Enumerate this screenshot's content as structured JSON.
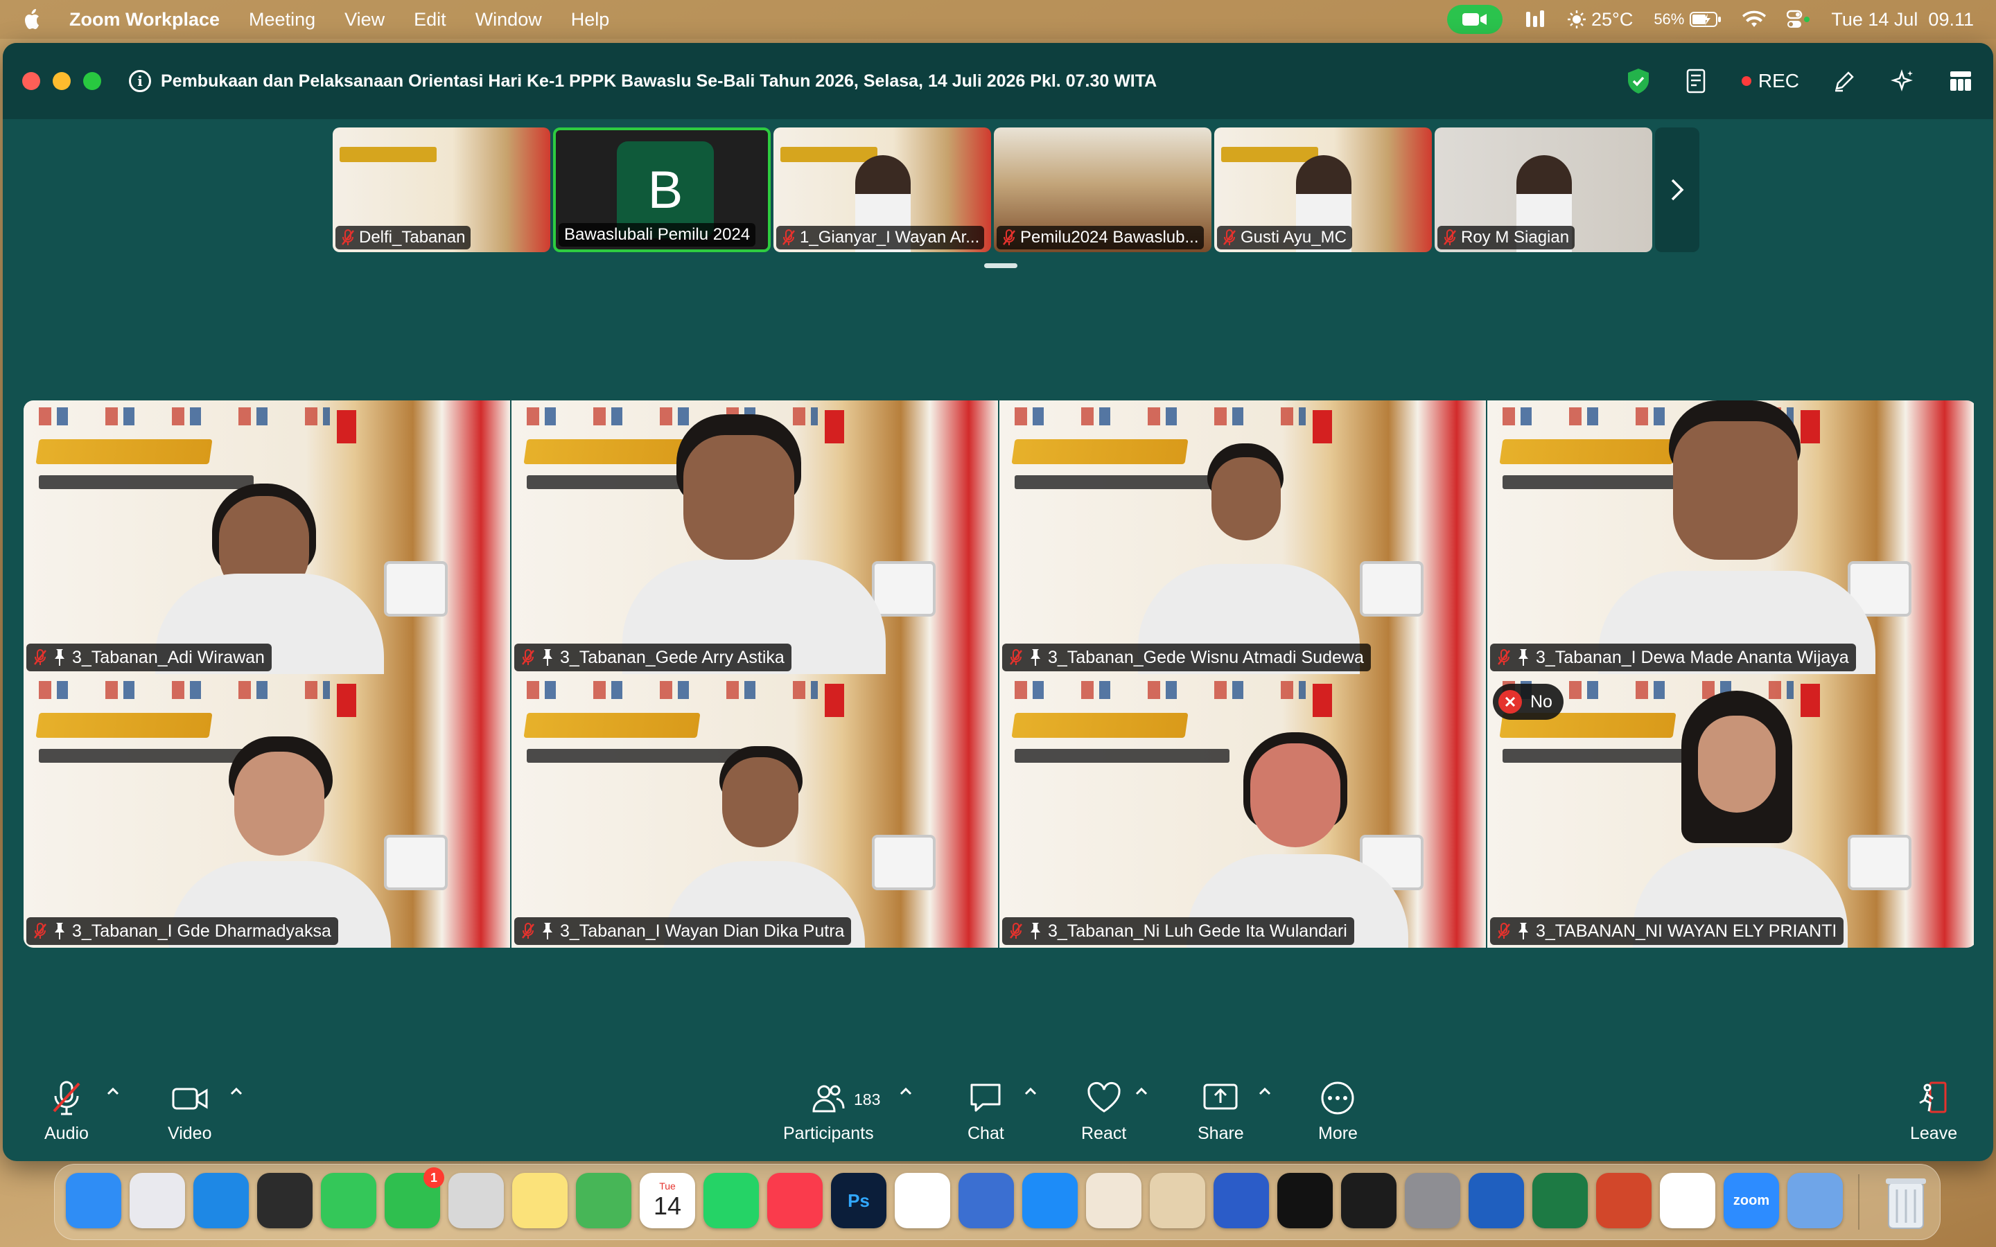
{
  "menubar": {
    "app_name": "Zoom Workplace",
    "menus": [
      "Meeting",
      "View",
      "Edit",
      "Window",
      "Help"
    ],
    "weather": "25°C",
    "battery": "56%",
    "clock": "Tue 14 Jul  09.11"
  },
  "window": {
    "meeting_title": "Pembukaan dan Pelaksanaan Orientasi Hari Ke-1 PPPK Bawaslu Se-Bali Tahun 2026, Selasa, 14 Juli 2026 Pkl. 07.30 WITA",
    "rec_label": "REC"
  },
  "filmstrip": [
    {
      "name": "Delfi_Tabanan",
      "muted": true,
      "kind": "slide"
    },
    {
      "name": "Bawaslubali Pemilu 2024",
      "muted": false,
      "kind": "avatar",
      "avatar_letter": "B"
    },
    {
      "name": "1_Gianyar_I Wayan Ar...",
      "muted": true,
      "kind": "person"
    },
    {
      "name": "Pemilu2024 Bawaslub...",
      "muted": true,
      "kind": "room"
    },
    {
      "name": "Gusti Ayu_MC",
      "muted": true,
      "kind": "person"
    },
    {
      "name": "Roy M Siagian",
      "muted": true,
      "kind": "person"
    }
  ],
  "gallery": [
    {
      "name": "3_Tabanan_Adi Wirawan",
      "pinned": true
    },
    {
      "name": "3_Tabanan_Gede Arry Astika",
      "pinned": true
    },
    {
      "name": "3_Tabanan_Gede Wisnu Atmadi Sudewa",
      "pinned": true
    },
    {
      "name": "3_Tabanan_I Dewa Made Ananta Wijaya",
      "pinned": true
    },
    {
      "name": "3_Tabanan_I Gde Dharmadyaksa",
      "pinned": true
    },
    {
      "name": "3_Tabanan_I Wayan Dian Dika Putra",
      "pinned": true
    },
    {
      "name": "3_Tabanan_Ni Luh Gede Ita Wulandari",
      "pinned": true
    },
    {
      "name": "3_TABANAN_NI WAYAN ELY PRIANTI",
      "pinned": true
    }
  ],
  "reaction_badge": {
    "label": "No"
  },
  "toolbar": {
    "audio": "Audio",
    "video": "Video",
    "participants": "Participants",
    "participants_count": "183",
    "chat": "Chat",
    "react": "React",
    "share": "Share",
    "more": "More",
    "leave": "Leave"
  },
  "dock": {
    "apps": [
      {
        "name": "finder",
        "label": "",
        "color": "#2f8df5"
      },
      {
        "name": "launchpad",
        "label": "",
        "color": "#e9e9ee"
      },
      {
        "name": "safari",
        "label": "",
        "color": "#1e88e5"
      },
      {
        "name": "keychain",
        "label": "",
        "color": "#2c2c2c"
      },
      {
        "name": "messages",
        "label": "",
        "color": "#34c759"
      },
      {
        "name": "facetime",
        "label": "",
        "color": "#2fbf4f",
        "badge": "1"
      },
      {
        "name": "calculator",
        "label": "",
        "color": "#d8d8d8"
      },
      {
        "name": "notes",
        "label": "",
        "color": "#fbe27a"
      },
      {
        "name": "find-my",
        "label": "",
        "color": "#47b657"
      },
      {
        "name": "calendar",
        "label": "14",
        "month": "Tue",
        "color": "#ffffff"
      },
      {
        "name": "whatsapp",
        "label": "",
        "color": "#25d366"
      },
      {
        "name": "music",
        "label": "",
        "color": "#fa3b4c"
      },
      {
        "name": "photoshop",
        "label": "Ps",
        "color": "#0b1e3a"
      },
      {
        "name": "capcut",
        "label": "",
        "color": "#ffffff"
      },
      {
        "name": "migrate",
        "label": "",
        "color": "#3b6fd1"
      },
      {
        "name": "app-store",
        "label": "",
        "color": "#1d8cf8"
      },
      {
        "name": "stack",
        "label": "",
        "color": "#f1e6d6"
      },
      {
        "name": "reader",
        "label": "",
        "color": "#e5d1ad"
      },
      {
        "name": "dictionary",
        "label": "",
        "color": "#2b5cc8"
      },
      {
        "name": "spotify",
        "label": "",
        "color": "#121212"
      },
      {
        "name": "istat",
        "label": "",
        "color": "#1c1c1c"
      },
      {
        "name": "system-settings",
        "label": "",
        "color": "#8e8e93"
      },
      {
        "name": "word",
        "label": "",
        "color": "#1f5fbf"
      },
      {
        "name": "excel",
        "label": "",
        "color": "#1d7a44"
      },
      {
        "name": "powerpoint",
        "label": "",
        "color": "#d2472a"
      },
      {
        "name": "chrome",
        "label": "",
        "color": "#ffffff"
      },
      {
        "name": "zoom",
        "label": "zoom",
        "color": "#2d8cff"
      },
      {
        "name": "iphone-mirroring",
        "label": "",
        "color": "#6fa5e8"
      }
    ]
  },
  "colors": {
    "window_bg": "#12514f",
    "titlebar_bg": "#0d3f3e",
    "active_speaker": "#2ecc40",
    "muted_red": "#e5322d",
    "rec_red": "#ff3b3b"
  }
}
